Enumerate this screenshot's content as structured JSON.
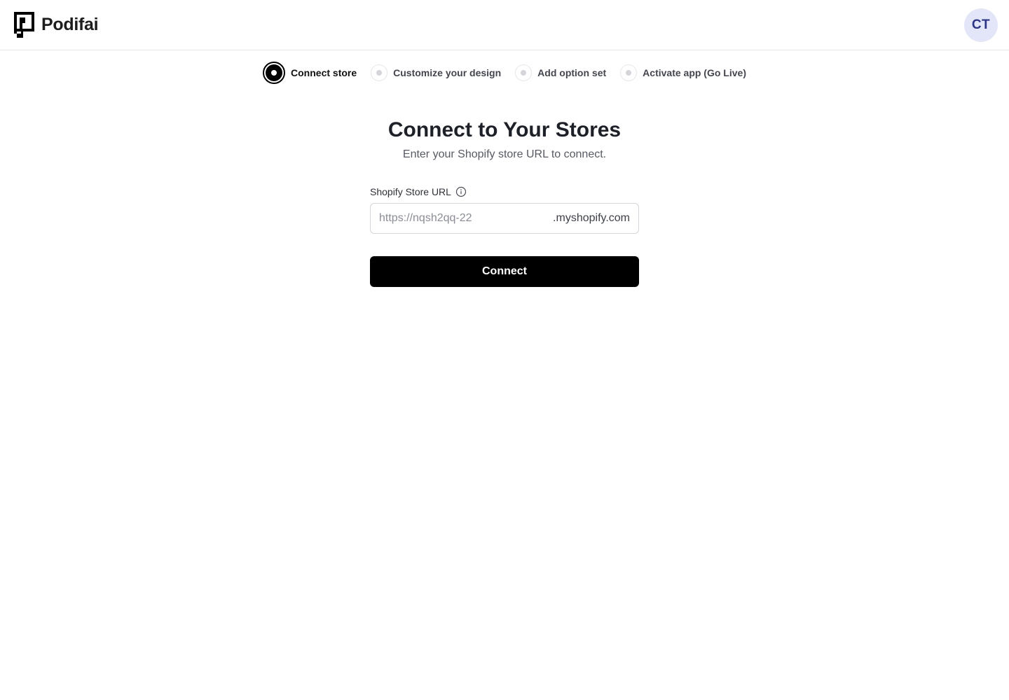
{
  "header": {
    "brand_name": "Podifai",
    "user_initials": "CT"
  },
  "stepper": {
    "steps": [
      {
        "label": "Connect store",
        "state": "active"
      },
      {
        "label": "Customize your design",
        "state": "pending"
      },
      {
        "label": "Add option set",
        "state": "pending"
      },
      {
        "label": "Activate app (Go Live)",
        "state": "pending"
      }
    ]
  },
  "main": {
    "title": "Connect to Your Stores",
    "subtitle": "Enter your Shopify store URL to connect.",
    "field": {
      "label": "Shopify Store URL",
      "value": "",
      "placeholder": "https://nqsh2qq-22",
      "suffix": ".myshopify.com"
    },
    "connect_label": "Connect"
  },
  "colors": {
    "accent": "#000000",
    "avatar_bg": "#e3e6f8",
    "avatar_text": "#2c3585",
    "border": "#e5e7eb"
  },
  "icons": {
    "logo": "podifai-logo-icon",
    "info": "info-icon"
  }
}
